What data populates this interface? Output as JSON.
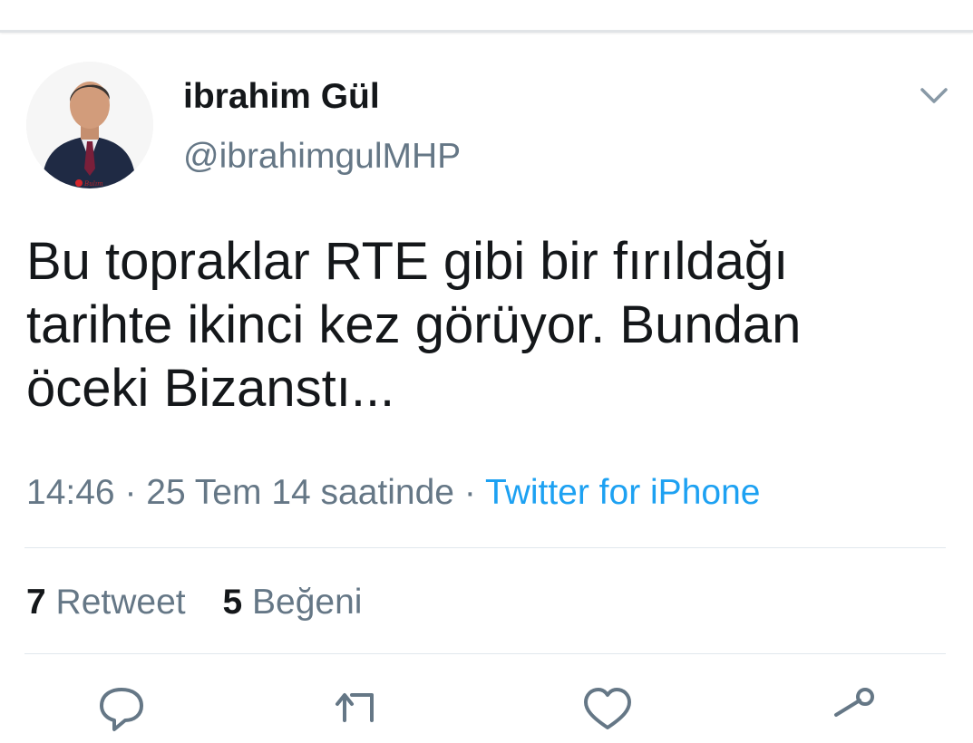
{
  "author": {
    "name": "ibrahim Gül",
    "handle": "@ibrahimgulMHP",
    "avatar_badge_text": "Bulım"
  },
  "tweet": {
    "text_lines": [
      "Bu topraklar RTE gibi bir fırıldağı",
      "tarihte ikinci kez görüyor. Bundan",
      "öceki Bizanstı..."
    ],
    "time": "14:46",
    "date": "25 Tem 14 saatinde",
    "separator": "·",
    "source": "Twitter for iPhone"
  },
  "stats": {
    "retweets_count": "7",
    "retweets_label": "Retweet",
    "likes_count": "5",
    "likes_label": "Beğeni"
  },
  "icons": {
    "menu": "chevron-down-icon",
    "reply": "reply-icon",
    "retweet": "retweet-icon",
    "like": "heart-icon",
    "share": "share-icon"
  },
  "colors": {
    "text": "#14171a",
    "secondary": "#657786",
    "link": "#1da1f2",
    "divider": "#e1e8ed"
  }
}
